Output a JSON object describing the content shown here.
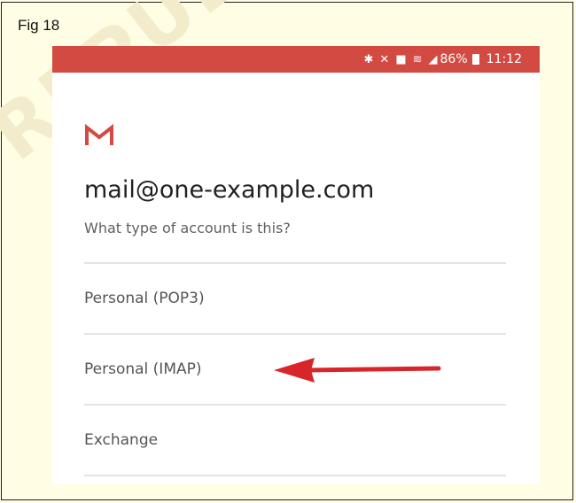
{
  "figure": {
    "label": "Fig 18",
    "watermark": "REPUBLISHED"
  },
  "statusbar": {
    "battery": "86%",
    "time": "11:12",
    "icons": [
      "bluetooth-icon",
      "mute-icon",
      "alarm-icon",
      "wifi-icon",
      "signal-icon",
      "battery-icon"
    ]
  },
  "account": {
    "email": "mail@one-example.com",
    "prompt": "What type of account is this?"
  },
  "options": [
    {
      "label": "Personal (POP3)"
    },
    {
      "label": "Personal (IMAP)"
    },
    {
      "label": "Exchange"
    }
  ],
  "colors": {
    "accent": "#d24a42",
    "arrow": "#d8252a",
    "background": "#fffde3"
  }
}
